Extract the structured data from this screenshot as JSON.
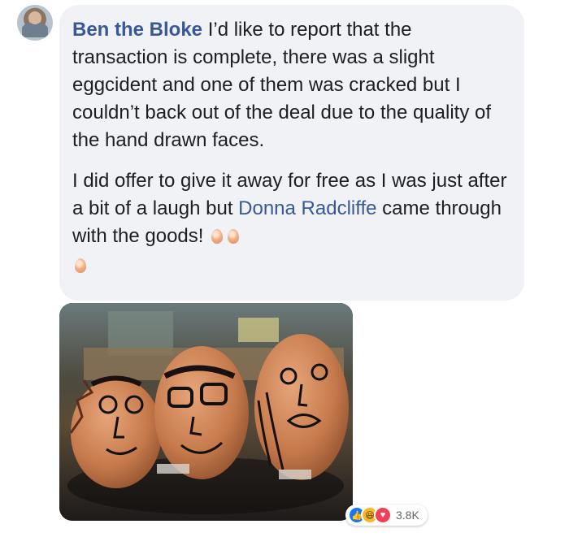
{
  "comment": {
    "author": "Ben the Bloke",
    "paragraph1": "I’d like to report that the transaction is complete, there was a slight eggcident and one of them was cracked but I couldn’t back out of the deal due to the quality of the hand drawn faces.",
    "paragraph2_before": "I did offer to give it away for free as I was just after a bit of a laugh but",
    "mention": "Donna Radcliffe",
    "paragraph2_after": "came through with the goods!",
    "emojis": [
      "egg-icon",
      "egg-icon",
      "egg-icon"
    ]
  },
  "reactions": {
    "icons": [
      "like-icon",
      "haha-icon",
      "love-icon"
    ],
    "count": "3.8K"
  },
  "photo": {
    "description_icon": "photo-of-three-eggs-with-drawn-faces"
  },
  "colors": {
    "link": "#385898",
    "bubble": "#f0f2f5",
    "like": "#1877f2",
    "love": "#f33e58",
    "haha": "#f7b928"
  }
}
